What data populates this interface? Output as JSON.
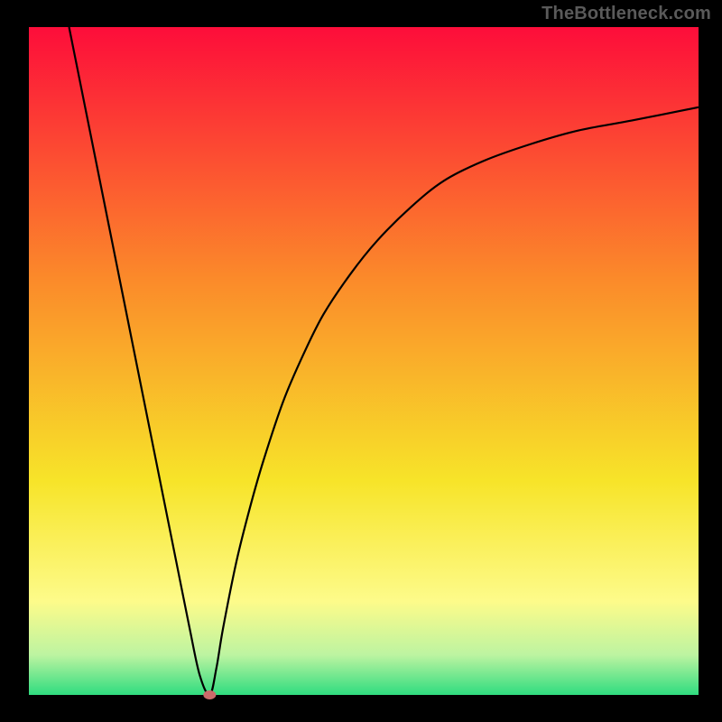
{
  "attribution": "TheBottleneck.com",
  "chart_data": {
    "type": "line",
    "title": "",
    "xlabel": "",
    "ylabel": "",
    "xlim": [
      0,
      100
    ],
    "ylim": [
      0,
      100
    ],
    "grid": false,
    "legend": false,
    "gradient_bg": {
      "top": "#fd0d3a",
      "mid1": "#fb8b2a",
      "mid2": "#f7e429",
      "mid3": "#fdfb8a",
      "mid4": "#bdf4a1",
      "bottom": "#2fdc7f"
    },
    "series": [
      {
        "name": "bottleneck-curve",
        "x": [
          6.0,
          8.0,
          10.0,
          12.0,
          14.0,
          16.0,
          18.0,
          20.0,
          22.0,
          24.0,
          25.5,
          27.0,
          28.0,
          29.0,
          31.0,
          33.0,
          35.0,
          38.0,
          41.0,
          44.0,
          48.0,
          52.0,
          57.0,
          62.0,
          68.0,
          75.0,
          82.0,
          90.0,
          100.0
        ],
        "y": [
          100.0,
          90.0,
          80.0,
          70.0,
          60.0,
          50.0,
          40.0,
          30.0,
          20.0,
          10.0,
          3.0,
          0.0,
          4.0,
          10.0,
          20.0,
          28.0,
          35.0,
          44.0,
          51.0,
          57.0,
          63.0,
          68.0,
          73.0,
          77.0,
          80.0,
          82.5,
          84.5,
          86.0,
          88.0
        ]
      }
    ],
    "minimum_marker": {
      "x": 27.0,
      "y": 0.0
    }
  }
}
